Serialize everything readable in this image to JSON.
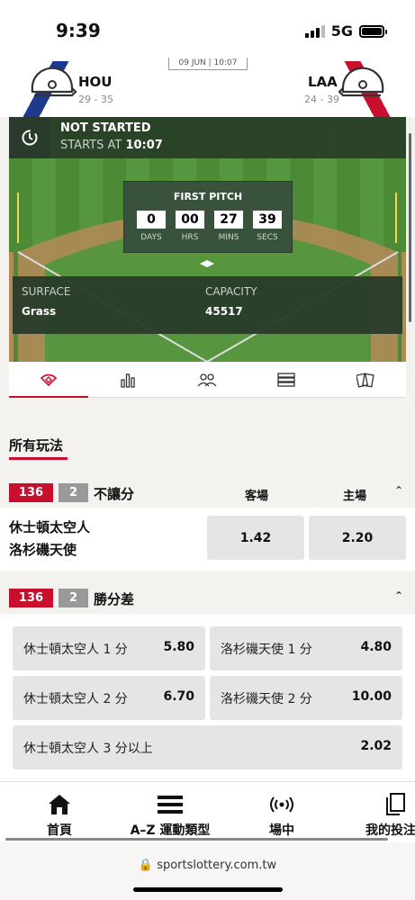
{
  "status_bar": {
    "time": "9:39",
    "network": "5G"
  },
  "match": {
    "date": "09 JUN | 10:07",
    "home": {
      "code": "HOU",
      "record": "29 - 35"
    },
    "away": {
      "code": "LAA",
      "record": "24 - 39"
    }
  },
  "game_status": {
    "title": "NOT STARTED",
    "starts_label": "STARTS AT",
    "starts_time": "10:07"
  },
  "countdown": {
    "title": "FIRST PITCH",
    "days": "0",
    "hrs": "00",
    "mins": "27",
    "secs": "39",
    "days_label": "DAYS",
    "hrs_label": "HRS",
    "mins_label": "MINS",
    "secs_label": "SECS"
  },
  "venue": {
    "surface_label": "SURFACE",
    "surface": "Grass",
    "capacity_label": "CAPACITY",
    "capacity": "45517"
  },
  "tabs": [
    {
      "icon": "baseball-field-icon",
      "active": true
    },
    {
      "icon": "bar-chart-icon"
    },
    {
      "icon": "players-icon"
    },
    {
      "icon": "list-icon"
    },
    {
      "icon": "cards-icon"
    }
  ],
  "section_title": "所有玩法",
  "market1": {
    "number": "136",
    "count": "2",
    "name": "不讓分",
    "col_away": "客場",
    "col_home": "主場",
    "team1": "休士頓太空人",
    "team2": "洛杉磯天使",
    "odds_away": "1.42",
    "odds_home": "2.20"
  },
  "market2": {
    "number": "136",
    "count": "2",
    "name": "勝分差",
    "rows": [
      {
        "left_label": "休士頓太空人 1 分",
        "left_odds": "5.80",
        "right_label": "洛杉磯天使 1 分",
        "right_odds": "4.80"
      },
      {
        "left_label": "休士頓太空人 2 分",
        "left_odds": "6.70",
        "right_label": "洛杉磯天使 2 分",
        "right_odds": "10.00"
      }
    ],
    "wide_label": "休士頓太空人 3 分以上",
    "wide_odds": "2.02"
  },
  "nav": {
    "home": "首頁",
    "az": "A–Z 運動類型",
    "live": "場中",
    "mybets": "我的投注"
  },
  "url": "sportslottery.com.tw",
  "colors": {
    "accent": "#c8102e",
    "field_green": "#4d8a35",
    "panel": "#2a3c2a"
  }
}
